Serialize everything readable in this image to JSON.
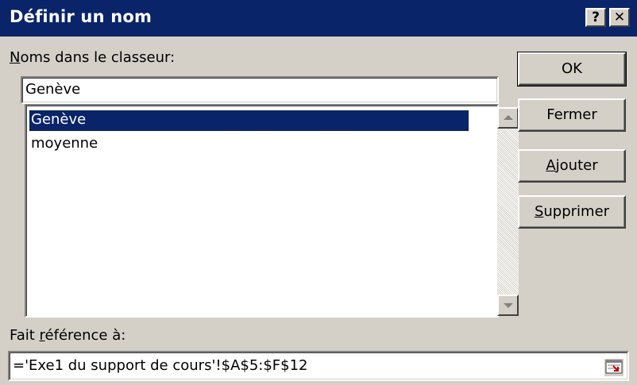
{
  "window": {
    "title": "Définir un nom",
    "help_label": "?",
    "close_label": "✕"
  },
  "names_section": {
    "label_accel": "N",
    "label_rest": "oms dans le classeur:",
    "input_value": "Genève",
    "list_items": [
      {
        "label": "Genève",
        "selected": true
      },
      {
        "label": "moyenne",
        "selected": false
      }
    ]
  },
  "reference_section": {
    "label_before": "Fait ",
    "label_accel": "r",
    "label_rest": "éférence à:",
    "input_value": "='Exe1 du support de cours'!$A$5:$F$12",
    "collapse_icon": "range-select-icon"
  },
  "buttons": {
    "ok": {
      "label": "OK"
    },
    "close": {
      "label": "Fermer"
    },
    "add": {
      "accel": "A",
      "rest": "jouter"
    },
    "delete": {
      "accel": "S",
      "rest": "upprimer"
    }
  }
}
